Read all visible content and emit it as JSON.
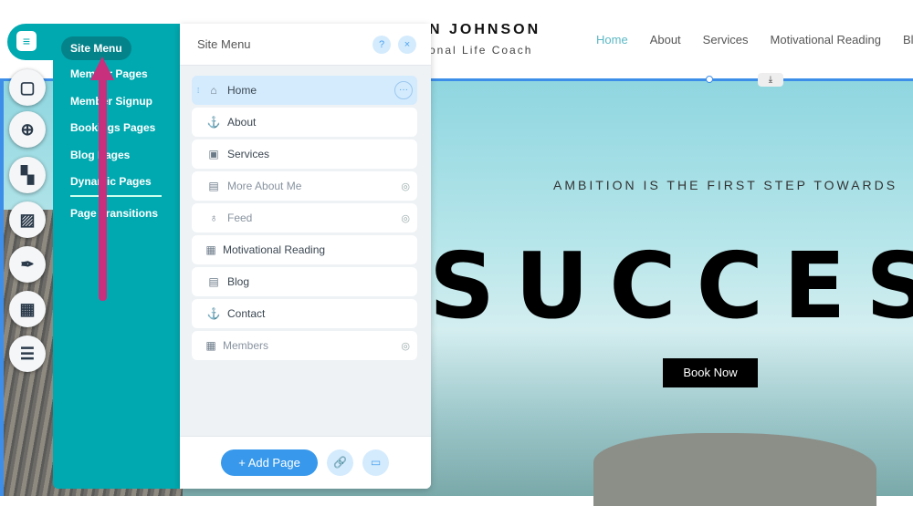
{
  "site": {
    "brand_name": "N JOHNSON",
    "brand_sub": "onal Life Coach",
    "nav": [
      "Home",
      "About",
      "Services",
      "Motivational Reading",
      "Blog"
    ],
    "tagline": "AMBITION IS THE FIRST STEP TOWARDS",
    "headline": "SUCCES",
    "cta": "Book Now",
    "download_icon": "⤓"
  },
  "toolbar": {
    "icons": [
      "pages-icon",
      "background-icon",
      "add-icon",
      "apps-icon",
      "media-icon",
      "blog-pen-icon",
      "bookings-icon",
      "database-icon"
    ]
  },
  "sidemenu": {
    "active": "Site Menu",
    "items": [
      "Member Pages",
      "Member Signup",
      "Bookings Pages",
      "Blog Pages",
      "Dynamic Pages",
      "Page Transitions"
    ]
  },
  "panel": {
    "title": "Site Menu",
    "help": "?",
    "close": "×",
    "pages": [
      {
        "label": "Home",
        "icon": "⌂",
        "selected": true,
        "hidden": false
      },
      {
        "label": "About",
        "icon": "⚓",
        "hidden": false
      },
      {
        "label": "Services",
        "icon": "▣",
        "hidden": false
      },
      {
        "label": "More About Me",
        "icon": "▤",
        "hidden": true
      },
      {
        "label": "Feed",
        "icon": "♁",
        "hidden": true
      },
      {
        "label": "Motivational Reading",
        "icon": "▦",
        "hidden": false
      },
      {
        "label": "Blog",
        "icon": "▤",
        "hidden": false
      },
      {
        "label": "Contact",
        "icon": "⚓",
        "hidden": false
      },
      {
        "label": "Members",
        "icon": "▦",
        "hidden": true
      }
    ],
    "more": "···",
    "drag": "⁞",
    "eye": "◎",
    "add_page": "+ Add Page",
    "link_icon": "🔗",
    "folder_icon": "▭"
  },
  "colors": {
    "accent": "#00a9b0",
    "primary": "#3899ec",
    "arrow": "#c8307e"
  }
}
